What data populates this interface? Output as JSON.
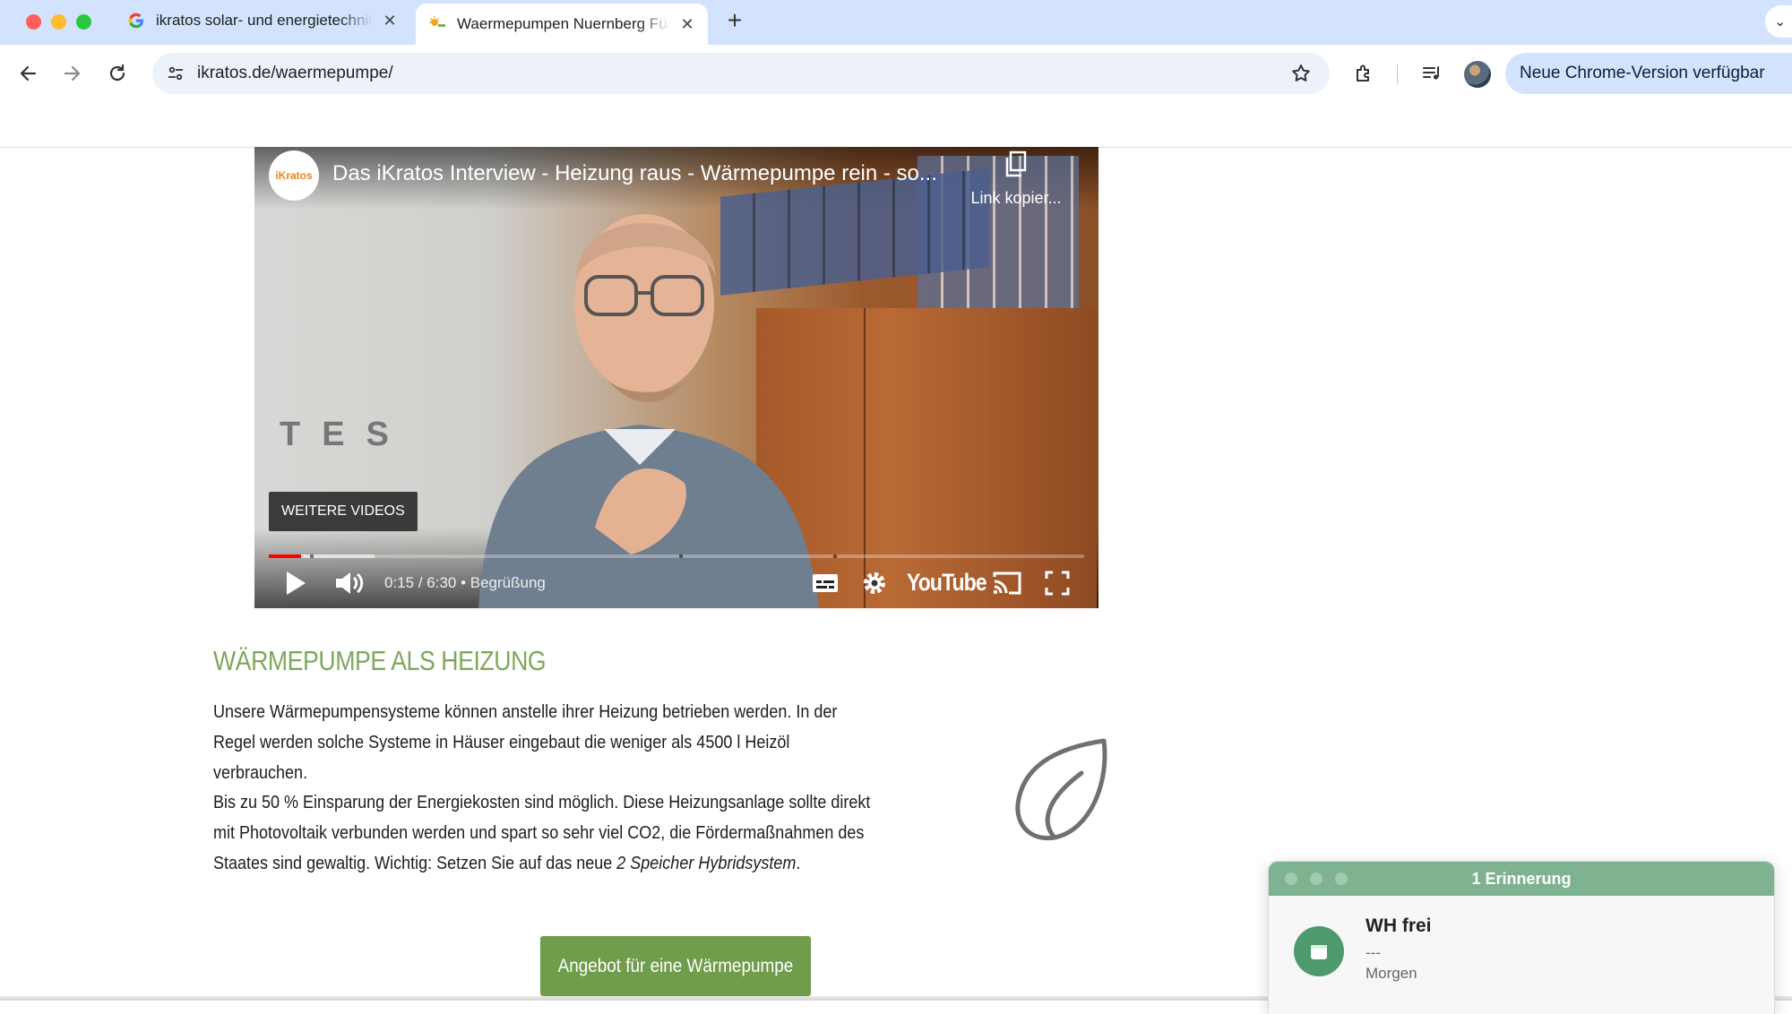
{
  "browser": {
    "tabs": [
      {
        "title": "ikratos solar- und energietechnik",
        "active": false
      },
      {
        "title": "Waermepumpen Nuernberg Fürth",
        "active": true
      }
    ],
    "new_tab_symbol": "+",
    "close_symbol": "✕",
    "url_domain": "ikratos.de",
    "url_path": "/waermepumpe/",
    "update_label": "Neue Chrome-Version verfügbar",
    "menu_symbol": "⋮"
  },
  "video": {
    "channel_logo_text": "iKratos",
    "title": "Das iKratos Interview - Heizung raus - Wärmepumpe rein - so...",
    "copy_link_label": "Link kopier...",
    "more_videos_label": "WEITERE VIDEOS",
    "time_current": "0:15",
    "time_total": "6:30",
    "chapter": "Begrüßung",
    "played_fraction": 0.04,
    "buffered_fraction": 0.13,
    "brand": "YouTube"
  },
  "content": {
    "heading": "WÄRMEPUMPE ALS HEIZUNG",
    "paragraph1": "Unsere Wärmepumpensysteme können anstelle ihrer Heizung betrieben werden. In der Regel werden solche Systeme in Häuser eingebaut die weniger als 4500 l Heizöl verbrauchen.",
    "paragraph2_text": "Bis zu 50 % Einsparung der Energiekosten sind möglich. Diese Heizungsanlage sollte direkt mit Photovoltaik verbunden werden und spart so sehr viel CO2, die Fördermaßnahmen des Staates sind gewaltig. Wichtig: Setzen Sie auf das neue ",
    "paragraph2_emphasis": "2 Speicher Hybridsystem",
    "paragraph2_end": ".",
    "cta_label": "Angebot für eine Wärmepumpe"
  },
  "reminder": {
    "header": "1 Erinnerung",
    "title": "WH frei",
    "subtitle": "---",
    "when": "Morgen"
  },
  "colors": {
    "accent_green": "#7ea85a",
    "button_green": "#6f9d4b",
    "reminder_header": "#7fb290",
    "youtube_red": "#ff0000"
  }
}
